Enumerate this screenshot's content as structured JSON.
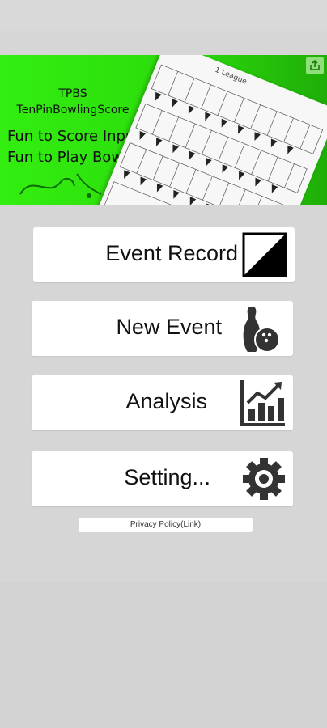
{
  "banner": {
    "app_abbreviation": "TPBS",
    "app_full_name": "TenPinBowlingScore",
    "tagline_line1": "Fun to Score Input,",
    "tagline_line2": "Fun to Play Bowling.",
    "screenshot_title": "1 League"
  },
  "menu": {
    "event_record": {
      "label": "Event Record",
      "icon": "half-filled-square-icon"
    },
    "new_event": {
      "label": "New Event",
      "icon": "bowling-pin-ball-icon"
    },
    "analysis": {
      "label": "Analysis",
      "icon": "bar-chart-trend-icon"
    },
    "setting": {
      "label": "Setting...",
      "icon": "gear-icon"
    }
  },
  "privacy_link": "Privacy Policy(Link)",
  "colors": {
    "banner_green": "#33ee10",
    "background": "#d6d6d6",
    "button_bg": "#ffffff",
    "icon_dark": "#333333"
  }
}
